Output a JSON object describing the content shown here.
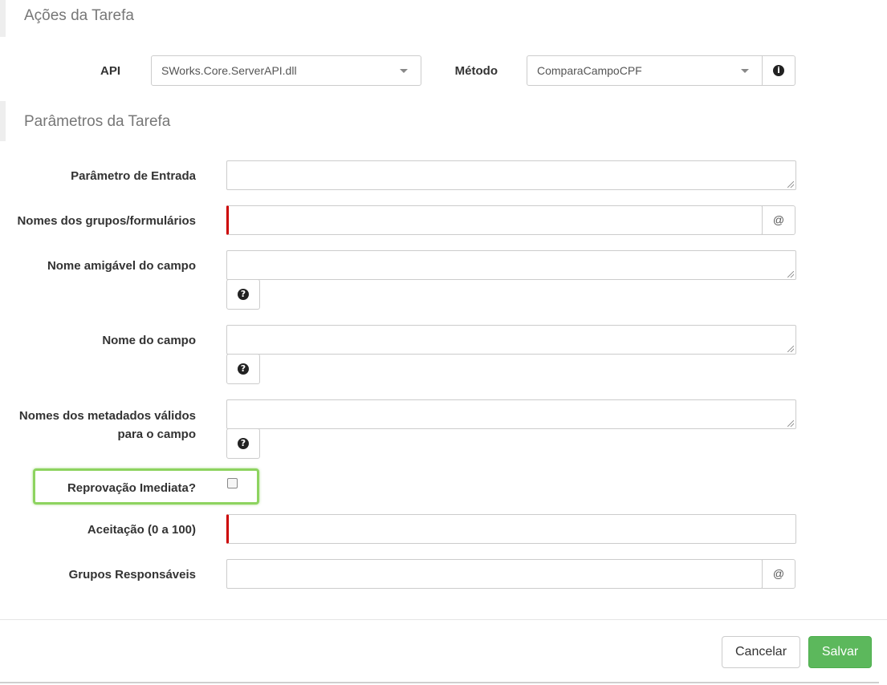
{
  "actions": {
    "title": "Ações da Tarefa",
    "api_label": "API",
    "api_value": "SWorks.Core.ServerAPI.dll",
    "method_label": "Método",
    "method_value": "ComparaCampoCPF"
  },
  "params": {
    "title": "Parâmetros da Tarefa",
    "entrada_label": "Parâmetro de Entrada",
    "grupos_form_label": "Nomes dos grupos/formulários",
    "amigavel_label": "Nome amigável do campo",
    "campo_label": "Nome do campo",
    "metadados_label_line1": "Nomes dos metadados válidos",
    "metadados_label_line2": "para o campo",
    "reprovacao_label": "Reprovação Imediata?",
    "aceitacao_label": "Aceitação (0 a 100)",
    "responsaveis_label": "Grupos Responsáveis",
    "at_symbol": "@",
    "question_glyph": "?",
    "info_glyph": "i"
  },
  "footer": {
    "cancel_label": "Cancelar",
    "save_label": "Salvar"
  },
  "colors": {
    "required_marker": "#cc0000",
    "highlight": "#8dd35f",
    "save_button": "#5cb85c"
  },
  "icons": [
    "info-icon",
    "question-circle-icon",
    "caret-down-icon"
  ]
}
